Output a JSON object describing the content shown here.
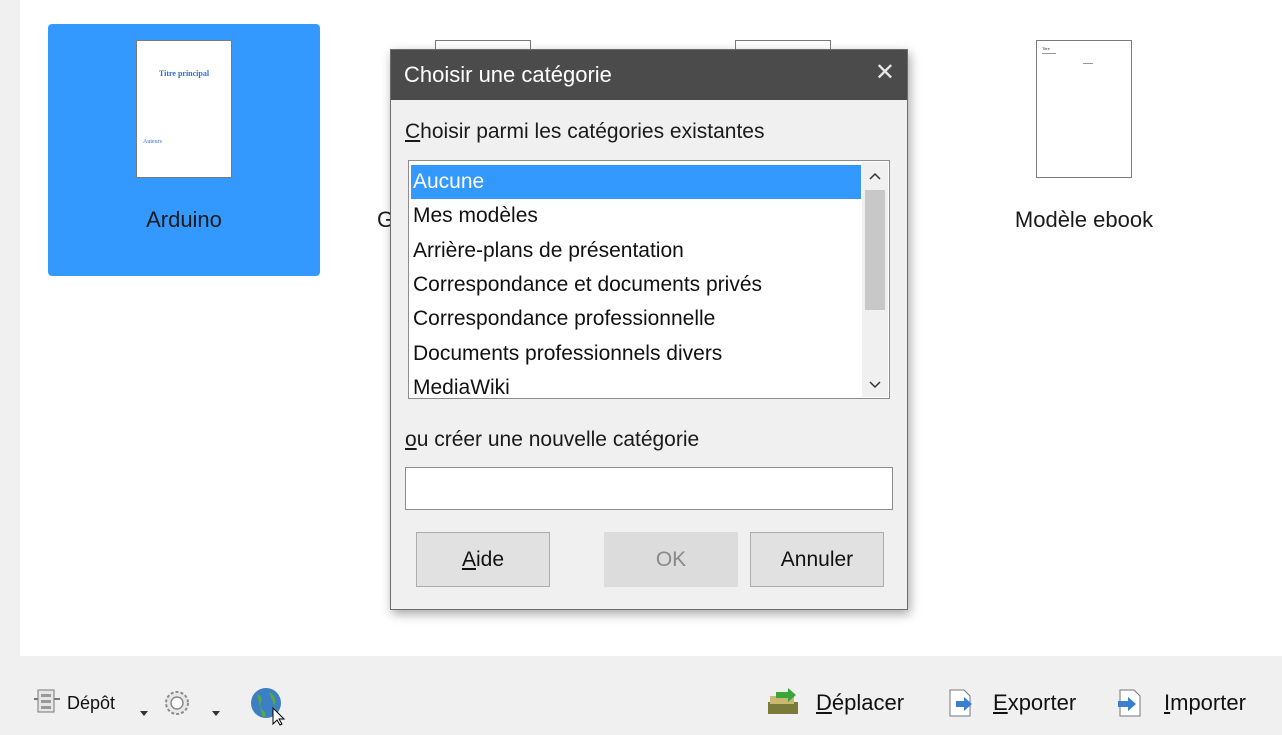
{
  "templates": [
    {
      "name": "Arduino",
      "thumb_title": "Titre principal",
      "thumb_sub": "Auteurs",
      "selected": true
    },
    {
      "name": "Modèle ebook",
      "thumb_title": "Titre",
      "selected": false
    }
  ],
  "partial_tile_letter": "G",
  "dialog": {
    "title": "Choisir une catégorie",
    "close_symbol": "✕",
    "existing_label": "Choisir parmi les catégories existantes",
    "existing_mnemonic": "C",
    "existing_rest": "hoisir parmi les catégories existantes",
    "categories": [
      "Aucune",
      "Mes modèles",
      "Arrière-plans de présentation",
      "Correspondance et documents privés",
      "Correspondance professionnelle",
      "Documents professionnels divers",
      "MediaWiki"
    ],
    "selected_index": 0,
    "new_label": "ou créer une nouvelle catégorie",
    "new_mnemonic": "o",
    "new_rest": "u créer une nouvelle catégorie",
    "new_value": "",
    "buttons": {
      "help": {
        "mnemonic": "A",
        "rest": "ide",
        "label": "Aide"
      },
      "ok": "OK",
      "cancel": "Annuler"
    }
  },
  "bottom_bar": {
    "repository": "Dépôt",
    "move": {
      "mnemonic": "D",
      "rest": "éplacer",
      "label": "Déplacer"
    },
    "export": {
      "mnemonic": "E",
      "rest": "xporter",
      "label": "Exporter"
    },
    "import": {
      "mnemonic": "I",
      "rest": "mporter",
      "label": "Importer"
    }
  },
  "colors": {
    "selection": "#3399ff",
    "titlebar": "#4b4b4b"
  },
  "icons": [
    "repository-icon",
    "settings-gear-icon",
    "globe-icon",
    "move-icon",
    "export-icon",
    "import-icon"
  ]
}
